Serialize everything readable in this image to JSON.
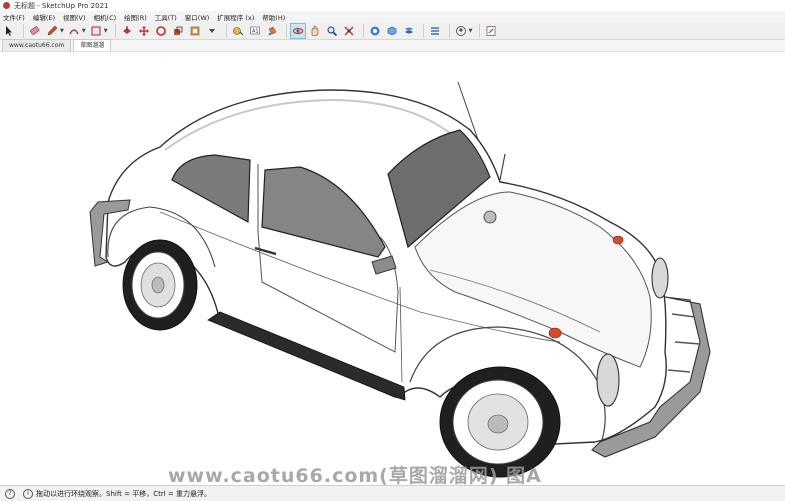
{
  "window": {
    "title": "无标题 - SketchUp Pro 2021"
  },
  "menu": [
    "文件(F)",
    "编辑(E)",
    "视图(V)",
    "相机(C)",
    "绘图(R)",
    "工具(T)",
    "窗口(W)",
    "扩展程序 (x)",
    "帮助(H)"
  ],
  "toolbar": {
    "icons": [
      "select-icon",
      "eraser-icon",
      "pencil-icon",
      "arc-icon",
      "shape-icon",
      "push-pull-icon",
      "move-icon",
      "rotate-icon",
      "scale-icon",
      "offset-icon",
      "tape-measure-icon",
      "text-icon",
      "paint-bucket-icon",
      "orbit-icon",
      "pan-icon",
      "zoom-icon",
      "zoom-extents-icon",
      "warehouse-icon",
      "extension-icon",
      "components-icon",
      "styles-icon",
      "user-icon",
      "report-icon"
    ]
  },
  "tabs": [
    {
      "label": "www.caotu66.com"
    },
    {
      "label": "草图溜溜"
    }
  ],
  "watermark": "www.caotu66.com(草图溜溜网) 图A",
  "status": {
    "text": "拖动以进行环绕观察。Shift = 平移，Ctrl = 重力悬浮。"
  },
  "colors": {
    "toolbar_bg": "#f0f0f0",
    "car_body": "#ffffff",
    "outline": "#333333"
  }
}
